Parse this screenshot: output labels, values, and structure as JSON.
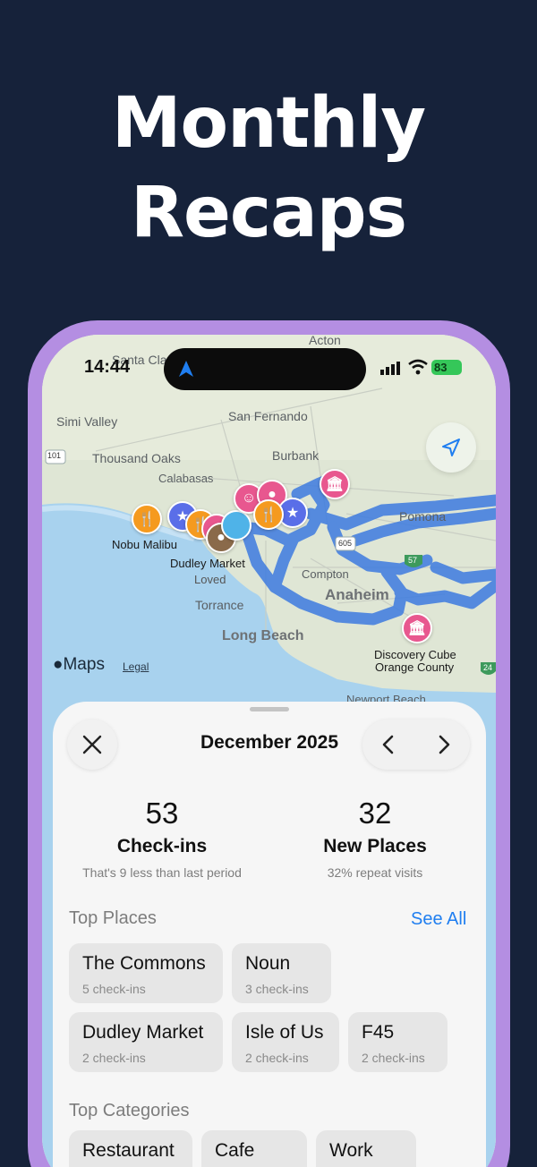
{
  "headline": {
    "line1": "Monthly",
    "line2": "Recaps"
  },
  "status_bar": {
    "time": "14:44",
    "battery": "83",
    "icons": [
      "location-arrow-icon",
      "cellular-signal-icon",
      "wifi-icon",
      "battery-icon"
    ]
  },
  "map": {
    "labels": {
      "acton": "Acton",
      "santa_clarita": "Santa Clari",
      "simi_valley": "Simi Valley",
      "san_fernando": "San Fernando",
      "thousand_oaks": "Thousand Oaks",
      "burbank": "Burbank",
      "calabasas": "Calabasas",
      "pomona": "Pomona",
      "compton": "Compton",
      "anaheim": "Anaheim",
      "torrance": "Torrance",
      "long_beach": "Long Beach",
      "newport_beach": "Newport Beach",
      "route_101": "101",
      "route_605": "605",
      "route_57": "57",
      "route_24": "24"
    },
    "pins": {
      "nobu_malibu": "Nobu Malibu",
      "dudley_market": "Dudley Market",
      "dudley_market_sub": "Loved",
      "discovery_cube_1": "Discovery Cube",
      "discovery_cube_2": "Orange County"
    },
    "attribution": {
      "brand": "Maps",
      "legal": "Legal"
    },
    "route_color": "#3d7be0",
    "pin_colors": {
      "food": "#f59a1f",
      "star": "#5a6ee8",
      "museum": "#e8578f"
    }
  },
  "sheet": {
    "month": "December 2025",
    "stats": [
      {
        "value": "53",
        "label": "Check-ins",
        "sub": "That's 9 less than last period"
      },
      {
        "value": "32",
        "label": "New Places",
        "sub": "32% repeat visits"
      }
    ],
    "top_places_title": "Top Places",
    "see_all": "See All",
    "top_places": [
      {
        "name": "The Commons",
        "count": "5 check-ins"
      },
      {
        "name": "Noun",
        "count": "3 check-ins"
      },
      {
        "name": "Dudley Market",
        "count": "2 check-ins"
      },
      {
        "name": "Isle of Us",
        "count": "2 check-ins"
      },
      {
        "name": "F45",
        "count": "2 check-ins"
      }
    ],
    "top_categories_title": "Top Categories",
    "top_categories": [
      "Restaurant",
      "Cafe",
      "Work"
    ]
  }
}
